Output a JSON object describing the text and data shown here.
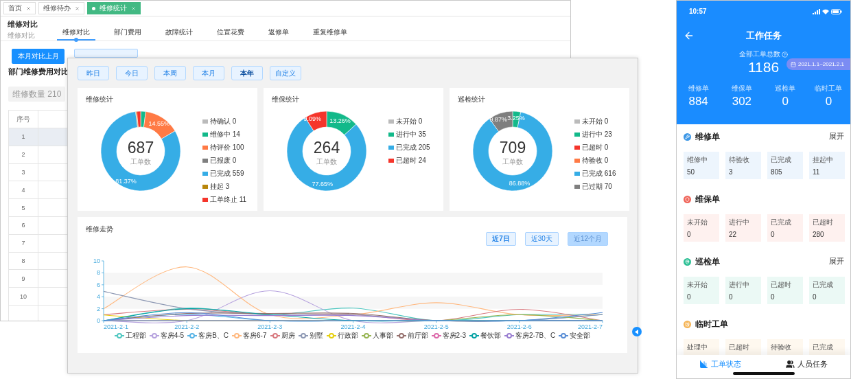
{
  "admin": {
    "tabs": [
      {
        "label": "首页",
        "selected": false
      },
      {
        "label": "维修待办",
        "selected": false
      },
      {
        "label": "维修统计",
        "selected": true
      }
    ],
    "page_title": "维修对比",
    "page_subtitle": "维修对比",
    "nav_tabs": [
      {
        "label": "维修对比",
        "selected": true
      },
      {
        "label": "部门费用",
        "selected": false
      },
      {
        "label": "故障统计",
        "selected": false
      },
      {
        "label": "位置花费",
        "selected": false
      },
      {
        "label": "返修单",
        "selected": false
      },
      {
        "label": "重复维修单",
        "selected": false
      }
    ],
    "buttons": [
      {
        "label": "本月对比上月",
        "selected": true
      },
      {
        "selected": false
      }
    ],
    "section_title": "部门维修费用对比",
    "count_bar": "维修数量 210",
    "table": {
      "columns": [
        "序号"
      ],
      "rows": [
        {
          "index": "1",
          "highlighted": true
        },
        {
          "index": "2",
          "highlighted": false
        },
        {
          "index": "3",
          "highlighted": false
        },
        {
          "index": "4",
          "highlighted": false
        },
        {
          "index": "5",
          "highlighted": false
        },
        {
          "index": "6",
          "highlighted": false
        },
        {
          "index": "7",
          "highlighted": false
        },
        {
          "index": "8",
          "highlighted": false
        },
        {
          "index": "9",
          "highlighted": false
        },
        {
          "index": "10",
          "highlighted": false
        }
      ]
    }
  },
  "dashboard": {
    "date_buttons": [
      {
        "label": "昨日",
        "selected": false
      },
      {
        "label": "今日",
        "selected": false
      },
      {
        "label": "本周",
        "selected": false
      },
      {
        "label": "本月",
        "selected": false
      },
      {
        "label": "本年",
        "selected": true
      },
      {
        "label": "自定义",
        "selected": false
      }
    ],
    "cards": [
      {
        "title": "维修统计",
        "total": "687",
        "total_label": "工单数",
        "counts": [
          "0",
          "14",
          "100",
          "0",
          "559",
          "3",
          "11"
        ],
        "chart_data": {
          "type": "donut",
          "categories": [
            "待确认",
            "维修中",
            "待评价",
            "已报废",
            "已完成",
            "挂起",
            "工单终止"
          ],
          "colors": [
            "#bbbbbb",
            "#13b98a",
            "#ff7a45",
            "#7f7f7f",
            "#36ade6",
            "#b8860b",
            "#f5352b"
          ],
          "values": [
            0,
            2.04,
            14.55,
            0,
            81.37,
            0.44,
            1.6
          ],
          "value_labels": [
            null,
            null,
            "14.55%",
            null,
            "81.37%",
            null,
            null
          ]
        }
      },
      {
        "title": "维保统计",
        "total": "264",
        "total_label": "工单数",
        "counts": [
          "0",
          "35",
          "205",
          "24"
        ],
        "chart_data": {
          "type": "donut",
          "categories": [
            "未开始",
            "进行中",
            "已完成",
            "已超时"
          ],
          "colors": [
            "#bbbbbb",
            "#13b98a",
            "#36ade6",
            "#f5352b"
          ],
          "values": [
            0,
            13.26,
            77.65,
            9.09
          ],
          "value_labels": [
            null,
            "13.26%",
            "77.65%",
            "9.09%"
          ]
        }
      },
      {
        "title": "巡检统计",
        "total": "709",
        "total_label": "工单数",
        "counts": [
          "0",
          "23",
          "0",
          "0",
          "616",
          "70"
        ],
        "chart_data": {
          "type": "donut",
          "categories": [
            "未开始",
            "进行中",
            "已超时",
            "待验收",
            "已完成",
            "已过期"
          ],
          "colors": [
            "#bbbbbb",
            "#13b98a",
            "#f5352b",
            "#ff7a45",
            "#36ade6",
            "#7f7f7f"
          ],
          "values": [
            0,
            3.25,
            0,
            0,
            86.88,
            9.87
          ],
          "value_labels": [
            null,
            "3.25%",
            null,
            null,
            "86.88%",
            "9.87%"
          ]
        }
      }
    ],
    "trend": {
      "title": "维修走势",
      "range_buttons": [
        {
          "label": "近7日",
          "selected": true,
          "pressed": false
        },
        {
          "label": "近30天",
          "selected": false,
          "pressed": false
        },
        {
          "label": "近12个月",
          "selected": false,
          "pressed": true
        }
      ],
      "y_ticks": [
        "10",
        "8",
        "6",
        "4",
        "2",
        "0"
      ],
      "x_labels": [
        "2021-2-1",
        "2021-2-2",
        "2021-2-3",
        "2021-2-4",
        "2021-2-5",
        "2021-2-6",
        "2021-2-7"
      ],
      "legend": [
        {
          "label": "工程部",
          "color": "#4fc7c0"
        },
        {
          "label": "客房4-5",
          "color": "#b6a2de"
        },
        {
          "label": "客房B、C",
          "color": "#59b4e6"
        },
        {
          "label": "客房6-7",
          "color": "#ffb980"
        },
        {
          "label": "厨房",
          "color": "#d87a80"
        },
        {
          "label": "别墅",
          "color": "#8d98b3"
        },
        {
          "label": "行政部",
          "color": "#e5cf0d"
        },
        {
          "label": "人事部",
          "color": "#97b552"
        },
        {
          "label": "前厅部",
          "color": "#95706d"
        },
        {
          "label": "客房2-3",
          "color": "#dc69aa"
        },
        {
          "label": "餐饮部",
          "color": "#07a2a4"
        },
        {
          "label": "客房2-7B、C",
          "color": "#9a7fd1"
        },
        {
          "label": "安全部",
          "color": "#588dd5"
        }
      ]
    }
  },
  "phone": {
    "time": "10:57",
    "title": "工作任务",
    "total_label": "全部工单总数",
    "total": "1186",
    "date_range": "2021.1.1~2021.2.1",
    "stats": [
      {
        "label": "维修单",
        "value": "884"
      },
      {
        "label": "维保单",
        "value": "302"
      },
      {
        "label": "巡检单",
        "value": "0"
      },
      {
        "label": "临时工单",
        "value": "0"
      }
    ],
    "sections": [
      {
        "title": "维修单",
        "color": "#3d97e6",
        "action": "展开",
        "tiles": [
          {
            "label": "维修中",
            "value": "50"
          },
          {
            "label": "待验收",
            "value": "3"
          },
          {
            "label": "已完成",
            "value": "805"
          },
          {
            "label": "挂起中",
            "value": "11"
          }
        ]
      },
      {
        "title": "维保单",
        "color": "#f0655a",
        "tiles": [
          {
            "label": "未开始",
            "value": "0"
          },
          {
            "label": "进行中",
            "value": "22"
          },
          {
            "label": "已完成",
            "value": "0"
          },
          {
            "label": "已超时",
            "value": "280"
          }
        ]
      },
      {
        "title": "巡检单",
        "color": "#2fc096",
        "action": "展开",
        "tiles": [
          {
            "label": "未开始",
            "value": "0"
          },
          {
            "label": "进行中",
            "value": "0"
          },
          {
            "label": "已超时",
            "value": "0"
          },
          {
            "label": "已完成",
            "value": "0"
          }
        ]
      },
      {
        "title": "临时工单",
        "color": "#f5b455",
        "tiles": [
          {
            "label": "处理中"
          },
          {
            "label": "已超时"
          },
          {
            "label": "待验收"
          },
          {
            "label": "已完成"
          }
        ]
      }
    ],
    "bottom_nav": [
      {
        "label": "工单状态",
        "selected": true
      },
      {
        "label": "人员任务",
        "selected": false
      }
    ]
  }
}
